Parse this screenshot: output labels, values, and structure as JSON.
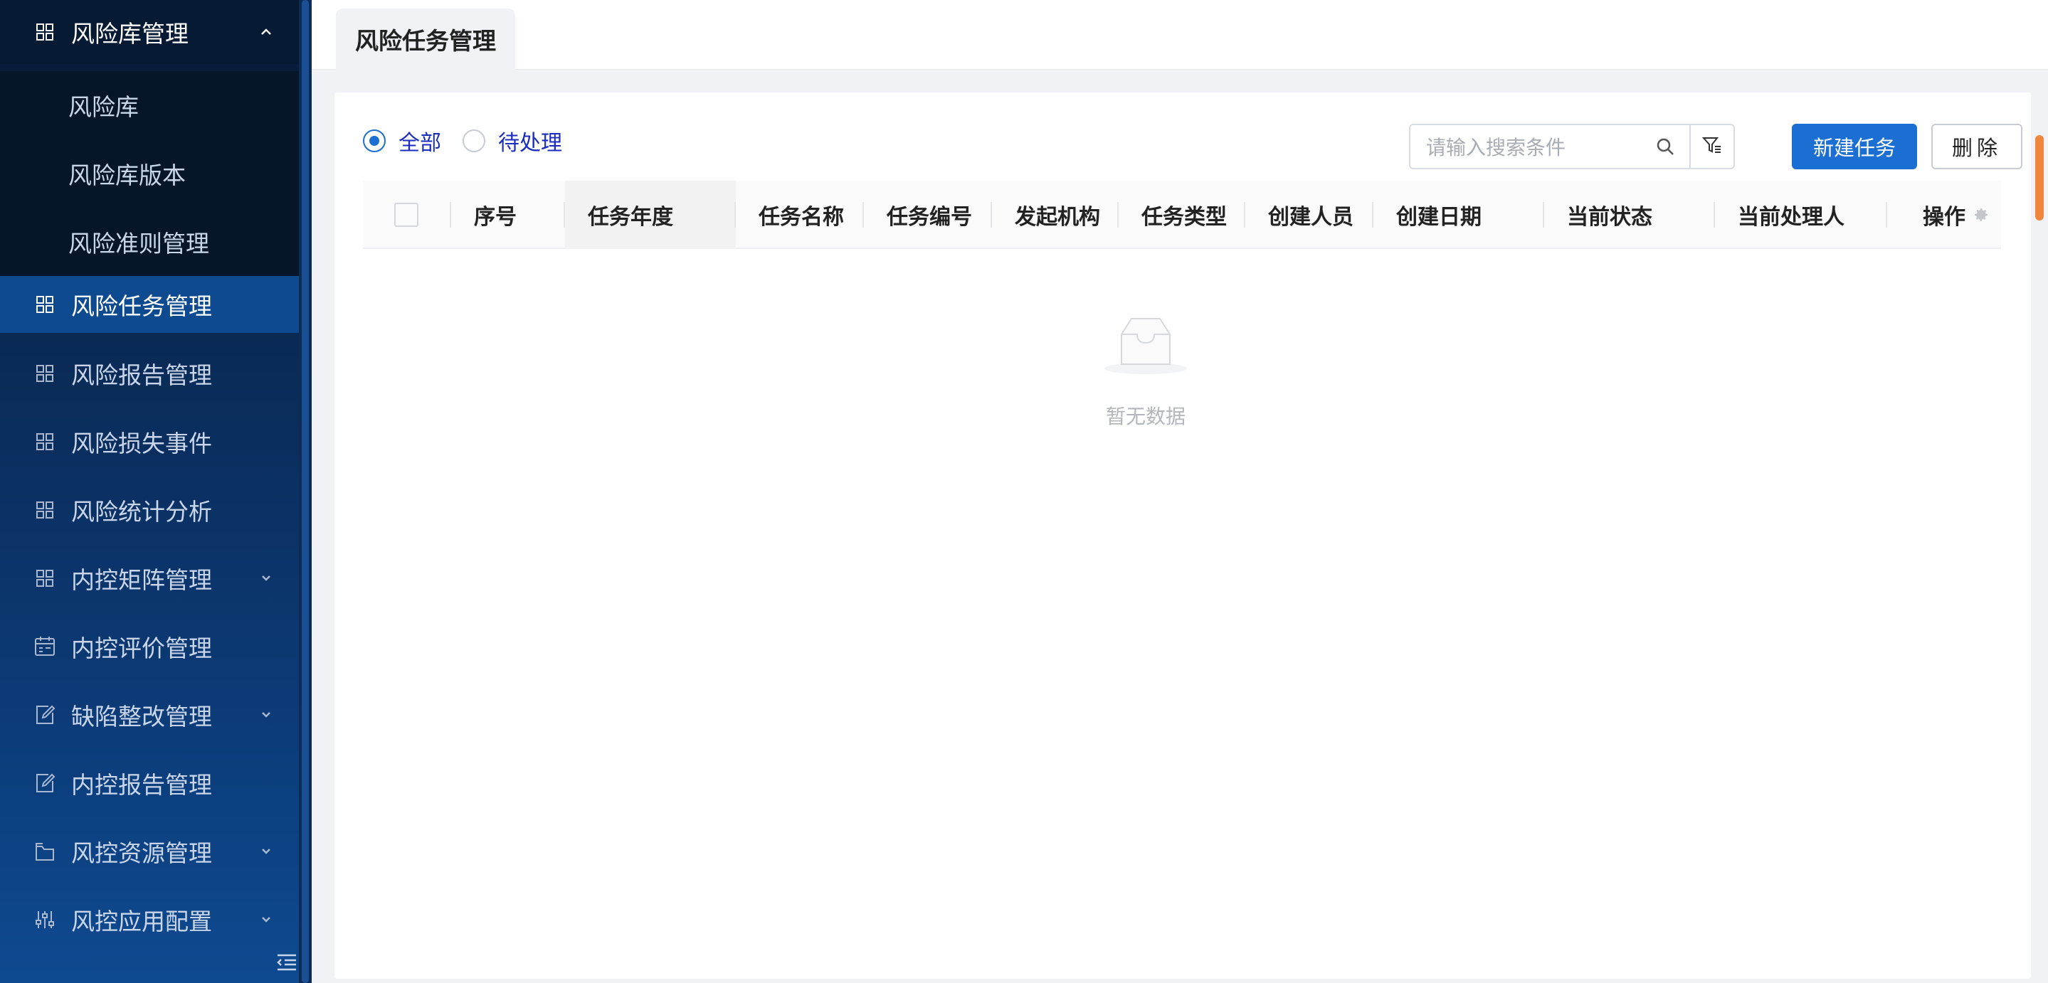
{
  "sidebar": {
    "items": [
      {
        "label": "风险库管理",
        "icon": "grid-icon",
        "chevron": "up"
      },
      {
        "label": "风险库"
      },
      {
        "label": "风险库版本"
      },
      {
        "label": "风险准则管理"
      },
      {
        "label": "风险任务管理",
        "icon": "grid-icon",
        "active": true
      },
      {
        "label": "风险报告管理",
        "icon": "grid-icon"
      },
      {
        "label": "风险损失事件",
        "icon": "grid-icon"
      },
      {
        "label": "风险统计分析",
        "icon": "grid-icon"
      },
      {
        "label": "内控矩阵管理",
        "icon": "grid-icon",
        "chevron": "down"
      },
      {
        "label": "内控评价管理",
        "icon": "calendar-check-icon"
      },
      {
        "label": "缺陷整改管理",
        "icon": "edit-doc-icon",
        "chevron": "down"
      },
      {
        "label": "内控报告管理",
        "icon": "edit-doc-icon"
      },
      {
        "label": "风控资源管理",
        "icon": "folder-icon",
        "chevron": "down"
      },
      {
        "label": "风控应用配置",
        "icon": "sliders-icon",
        "chevron": "down"
      }
    ]
  },
  "tabs": [
    {
      "label": "风险任务管理"
    }
  ],
  "filters": {
    "options": [
      {
        "label": "全部",
        "checked": true
      },
      {
        "label": "待处理",
        "checked": false
      }
    ]
  },
  "search": {
    "placeholder": "请输入搜索条件",
    "value": ""
  },
  "toolbar": {
    "new_label": "新建任务",
    "delete_label": "删除"
  },
  "table": {
    "columns": [
      "序号",
      "任务年度",
      "任务名称",
      "任务编号",
      "发起机构",
      "任务类型",
      "创建人员",
      "创建日期",
      "当前状态",
      "当前处理人",
      "操作"
    ],
    "rows": []
  },
  "empty": {
    "text": "暂无数据"
  },
  "colors": {
    "primary": "#1b6fd3",
    "sidebar_dark": "#071a33",
    "sidebar_active": "#0e4a8f"
  }
}
